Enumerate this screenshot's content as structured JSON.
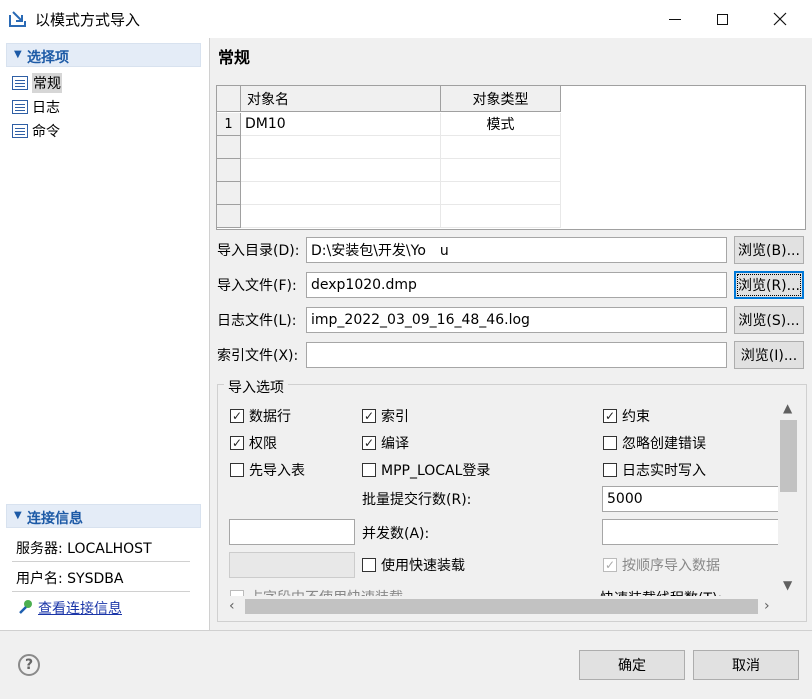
{
  "window": {
    "title": "以模式方式导入",
    "minimize_icon": "minimize-icon",
    "maximize_icon": "maximize-icon",
    "close_icon": "close-icon"
  },
  "sidebar": {
    "section_title": "选择项",
    "items": [
      {
        "label": "常规",
        "selected": true
      },
      {
        "label": "日志",
        "selected": false
      },
      {
        "label": "命令",
        "selected": false
      }
    ],
    "connection": {
      "section_title": "连接信息",
      "server": "服务器: LOCALHOST",
      "user": "用户名: SYSDBA",
      "view_link": "查看连接信息"
    }
  },
  "main": {
    "title": "常规",
    "table": {
      "columns": [
        "对象名",
        "对象类型"
      ],
      "rows": [
        {
          "index": "1",
          "name": "DM10",
          "type": "模式"
        }
      ]
    },
    "fields": {
      "dir_label": "导入目录(D):",
      "dir_value": "D:\\安装包\\开发\\Yo　u",
      "dir_browse": "浏览(B)...",
      "file_label": "导入文件(F):",
      "file_value": "dexp1020.dmp",
      "file_browse": "浏览(R)...",
      "log_label": "日志文件(L):",
      "log_value": "imp_2022_03_09_16_48_46.log",
      "log_browse": "浏览(S)...",
      "index_label": "索引文件(X):",
      "index_value": "",
      "index_browse": "浏览(I)..."
    },
    "options": {
      "legend": "导入选项",
      "rows_cb": {
        "label": "数据行",
        "checked": true
      },
      "index_cb": {
        "label": "索引",
        "checked": true
      },
      "constraint_cb": {
        "label": "约束",
        "checked": true
      },
      "grant_cb": {
        "label": "权限",
        "checked": true
      },
      "compile_cb": {
        "label": "编译",
        "checked": true
      },
      "ignore_cb": {
        "label": "忽略创建错误",
        "checked": false
      },
      "table_first_cb": {
        "label": "先导入表",
        "checked": false
      },
      "mpp_cb": {
        "label": "MPP_LOCAL登录",
        "checked": false
      },
      "log_realtime_cb": {
        "label": "日志实时写入",
        "checked": false
      },
      "batch_label": "批量提交行数(R):",
      "batch_value": "5000",
      "parallel_label": "并发数(A):",
      "parallel_value": "",
      "fast_load_cb": {
        "label": "使用快速装载",
        "checked": false
      },
      "order_cb": {
        "label": "按顺序导入数据",
        "checked": true
      },
      "cut_row_left": "占字段中不使用快速装载",
      "cut_row_right": "快速装载线程数(T):"
    }
  },
  "footer": {
    "ok": "确定",
    "cancel": "取消",
    "help_icon": "help-icon"
  }
}
